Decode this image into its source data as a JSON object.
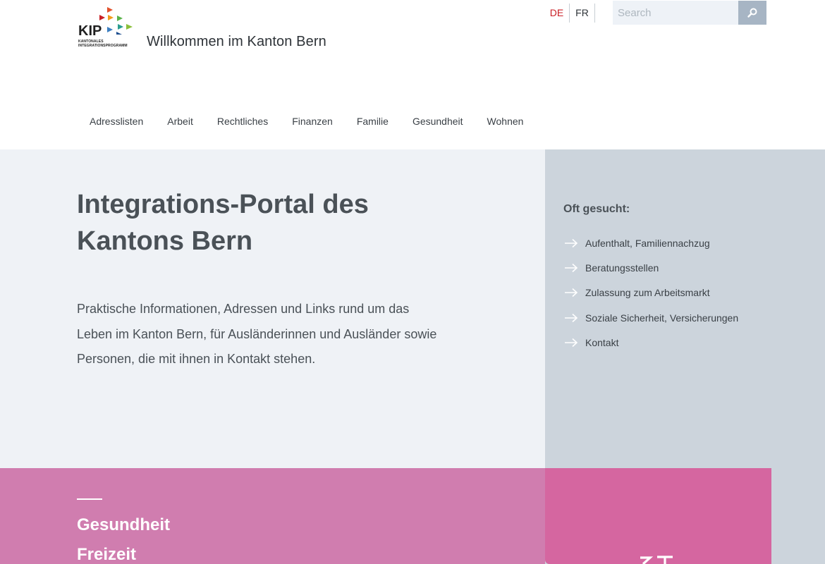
{
  "header": {
    "logo": {
      "word": "KIP",
      "subtitle_line1": "KANTONALES",
      "subtitle_line2": "INTEGRATIONSPROGRAMM",
      "triangle_colors": [
        "#e2512b",
        "#c91f25",
        "#f29c1c",
        "#2a9d8f",
        "#5ab34a",
        "#3d7fc1",
        "#8bbf3a",
        "#1d4e8f"
      ]
    },
    "site_title": "Willkommen im Kanton Bern",
    "languages": [
      {
        "code": "DE",
        "active": true
      },
      {
        "code": "FR",
        "active": false
      }
    ],
    "search": {
      "placeholder": "Search",
      "value": "",
      "button_icon": "search-icon"
    },
    "nav": [
      {
        "label": "Adresslisten"
      },
      {
        "label": "Arbeit"
      },
      {
        "label": "Rechtliches"
      },
      {
        "label": "Finanzen"
      },
      {
        "label": "Familie"
      },
      {
        "label": "Gesundheit"
      },
      {
        "label": "Wohnen"
      }
    ]
  },
  "hero": {
    "title_line1": "Integrations-Portal des",
    "title_line2": "Kantons Bern",
    "intro_line1": "Praktische Informationen, Adressen und Links rund um das",
    "intro_line2": "Leben im Kanton Bern, für Ausländerinnen und Ausländer sowie",
    "intro_line3": "Personen, die mit ihnen in Kontakt stehen."
  },
  "frequently_searched": {
    "title": "Oft gesucht:",
    "arrow_icon": "arrow-right-icon",
    "items": [
      {
        "label": "Aufenthalt, Familiennachzug"
      },
      {
        "label": "Beratungsstellen"
      },
      {
        "label": "Zulassung zum Arbeitsmarkt"
      },
      {
        "label": "Soziale Sicherheit, Versicherungen"
      },
      {
        "label": "Kontakt"
      }
    ]
  },
  "topics": {
    "items": [
      {
        "label": "Gesundheit"
      },
      {
        "label": "Freizeit"
      }
    ]
  },
  "colors": {
    "accent_red": "#c91f25",
    "hero_bg": "#eff2f6",
    "side_bg": "#ccd4dc",
    "band_pink": "#d07daf",
    "band_pink_dark": "#d566a0",
    "search_button": "#a7b5c4"
  }
}
